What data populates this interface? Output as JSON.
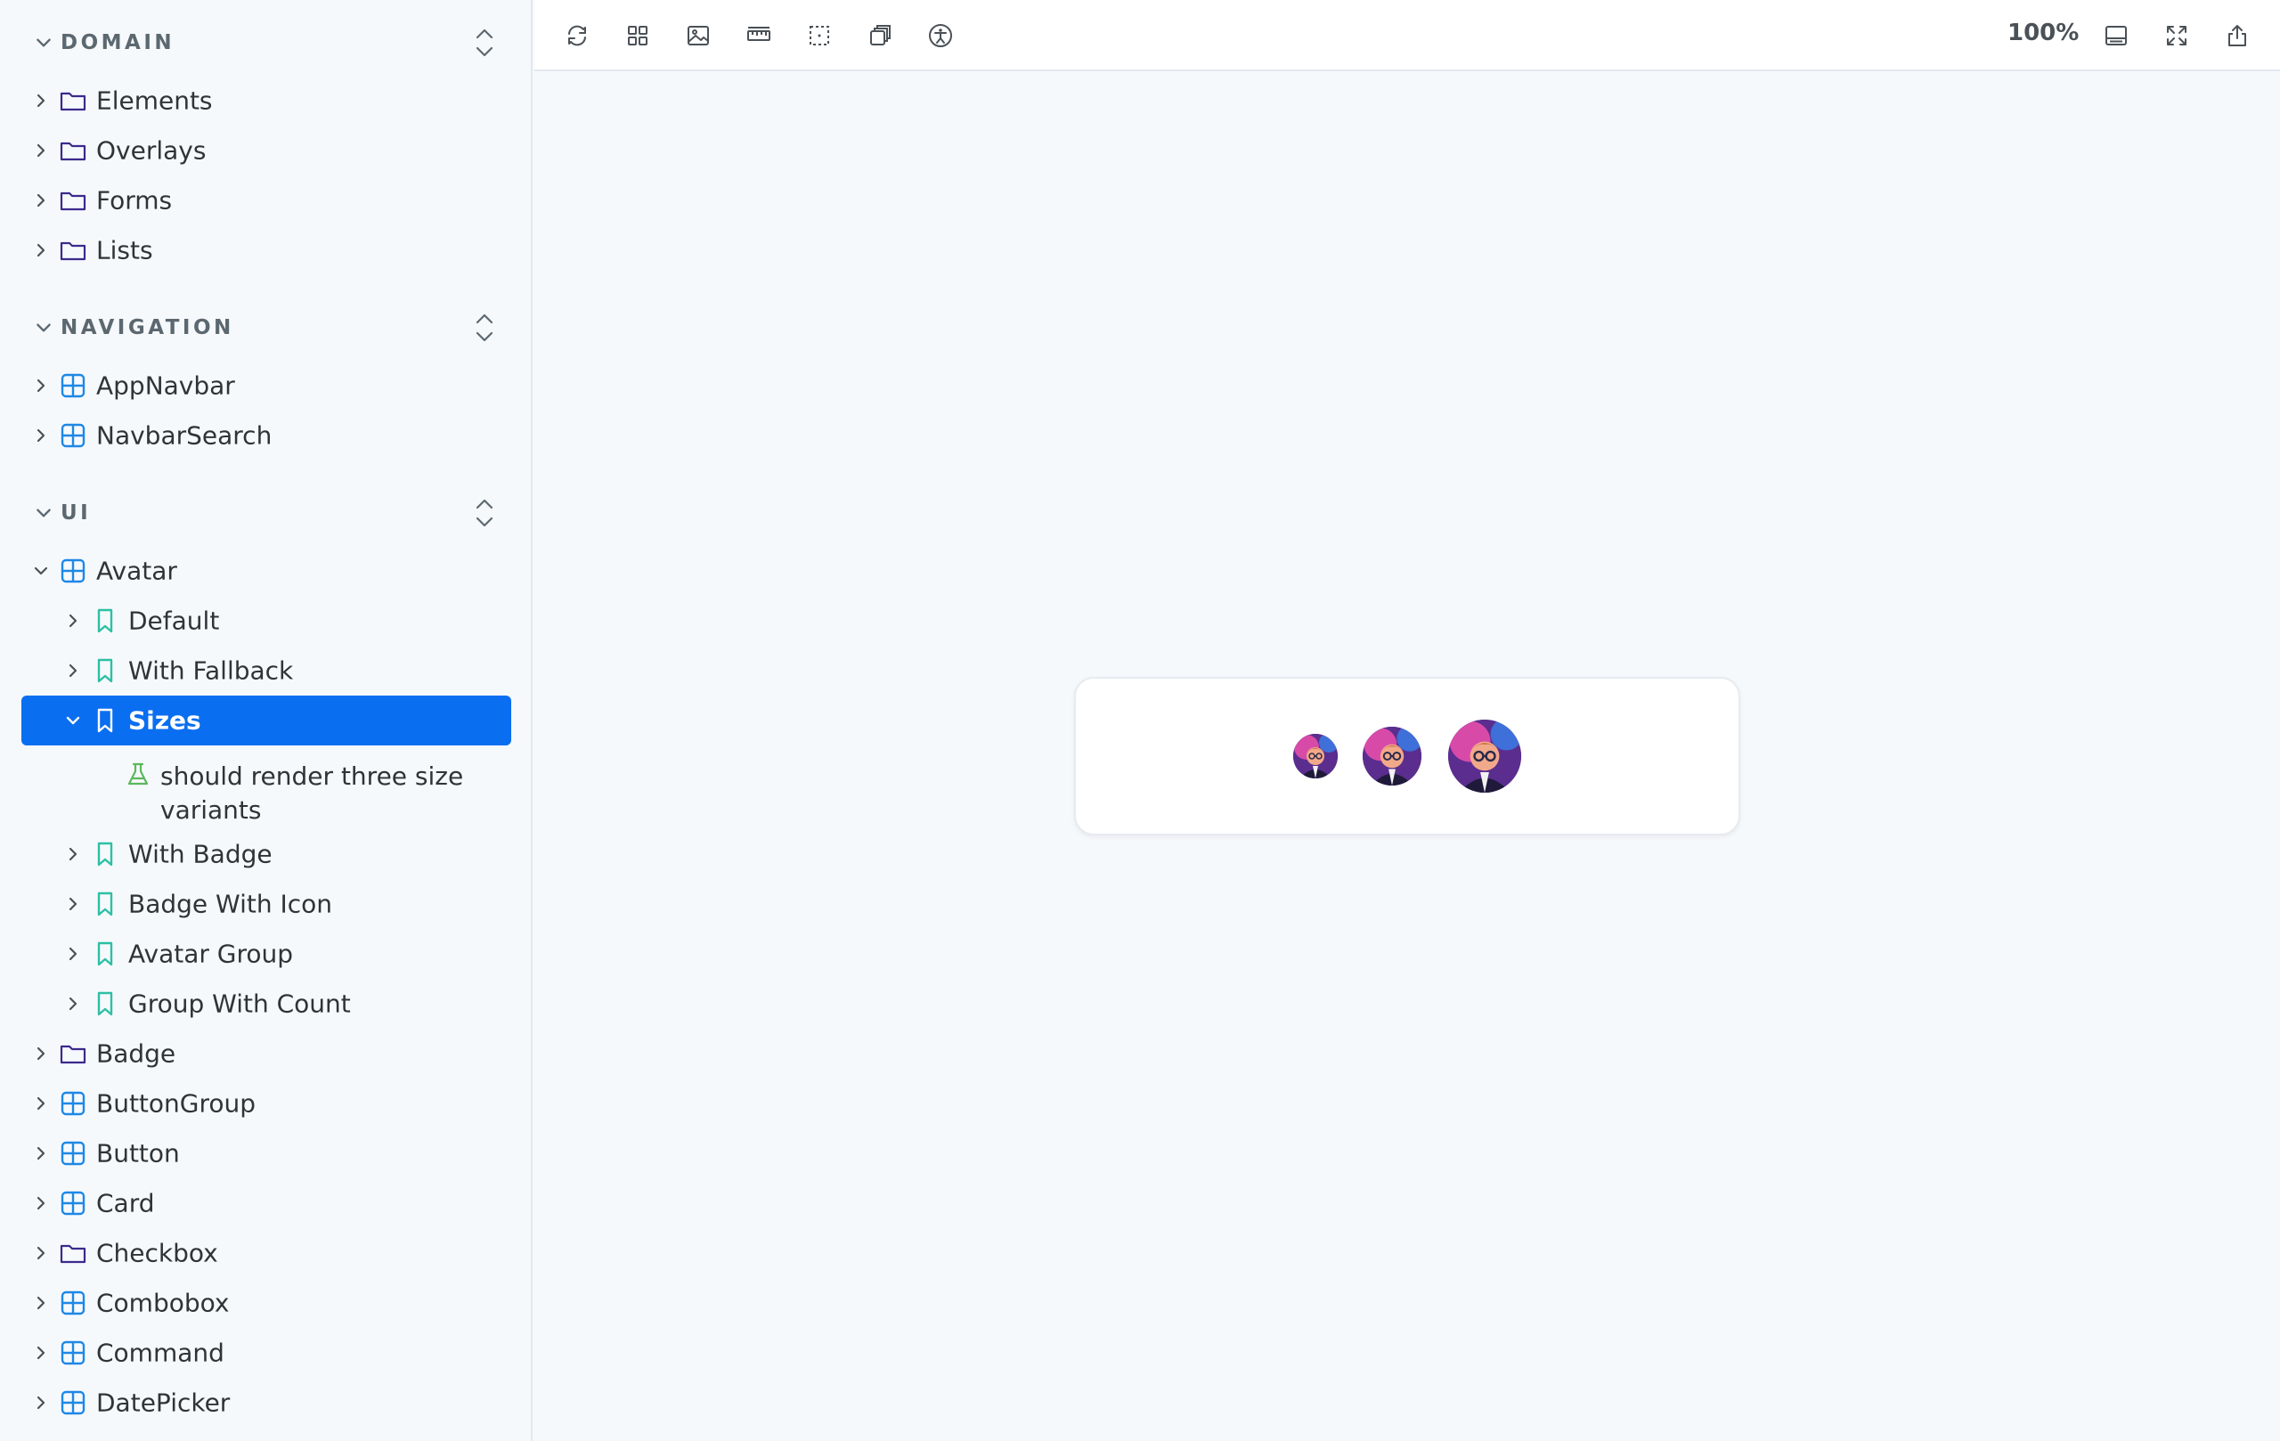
{
  "sidebar": {
    "sections": [
      {
        "title": "DOMAIN",
        "items": [
          {
            "label": "Elements",
            "icon": "folder-icon"
          },
          {
            "label": "Overlays",
            "icon": "folder-icon"
          },
          {
            "label": "Forms",
            "icon": "folder-icon"
          },
          {
            "label": "Lists",
            "icon": "folder-icon"
          }
        ]
      },
      {
        "title": "NAVIGATION",
        "items": [
          {
            "label": "AppNavbar",
            "icon": "component-icon"
          },
          {
            "label": "NavbarSearch",
            "icon": "component-icon"
          }
        ]
      },
      {
        "title": "UI",
        "items": [
          {
            "label": "Avatar",
            "icon": "component-icon",
            "expanded": true
          },
          {
            "label": "Default",
            "icon": "story-icon"
          },
          {
            "label": "With Fallback",
            "icon": "story-icon"
          },
          {
            "label": "Sizes",
            "icon": "story-icon",
            "selected": true,
            "expanded": true
          },
          {
            "label": "should render three size variants",
            "icon": "test-beaker-icon"
          },
          {
            "label": "With Badge",
            "icon": "story-icon"
          },
          {
            "label": "Badge With Icon",
            "icon": "story-icon"
          },
          {
            "label": "Avatar Group",
            "icon": "story-icon"
          },
          {
            "label": "Group With Count",
            "icon": "story-icon"
          },
          {
            "label": "Badge",
            "icon": "folder-icon"
          },
          {
            "label": "ButtonGroup",
            "icon": "component-icon"
          },
          {
            "label": "Button",
            "icon": "component-icon"
          },
          {
            "label": "Card",
            "icon": "component-icon"
          },
          {
            "label": "Checkbox",
            "icon": "folder-icon"
          },
          {
            "label": "Combobox",
            "icon": "component-icon"
          },
          {
            "label": "Command",
            "icon": "component-icon"
          },
          {
            "label": "DatePicker",
            "icon": "component-icon"
          }
        ]
      }
    ]
  },
  "toolbar": {
    "buttons": [
      "reload-icon",
      "grid-icon",
      "image-icon",
      "ruler-icon",
      "outline-icon",
      "layers-icon",
      "accessibility-icon"
    ],
    "zoom": "100%",
    "right_buttons": [
      "panel-icon",
      "fullscreen-icon",
      "share-icon"
    ]
  },
  "colors": {
    "accent": "#0a6ef0",
    "folder": "#3b2a8c",
    "component": "#1e88e5",
    "story": "#2ebfa5",
    "test": "#5cb85c"
  }
}
